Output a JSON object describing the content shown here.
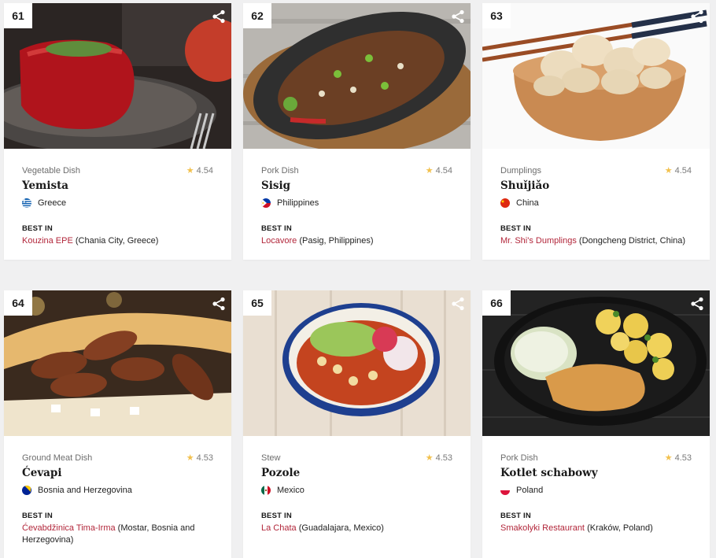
{
  "dishes": [
    {
      "rank": "61",
      "category": "Vegetable Dish",
      "rating": "4.54",
      "name": "Yemista",
      "country": "Greece",
      "best_in_label": "BEST IN",
      "venue": "Kouzina EPE",
      "location": "(Chania City, Greece)"
    },
    {
      "rank": "62",
      "category": "Pork Dish",
      "rating": "4.54",
      "name": "Sisig",
      "country": "Philippines",
      "best_in_label": "BEST IN",
      "venue": "Locavore",
      "location": "(Pasig, Philippines)"
    },
    {
      "rank": "63",
      "category": "Dumplings",
      "rating": "4.54",
      "name": "Shuǐjiǎo",
      "country": "China",
      "best_in_label": "BEST IN",
      "venue": "Mr. Shi's Dumplings",
      "location": "(Dongcheng District, China)"
    },
    {
      "rank": "64",
      "category": "Ground Meat Dish",
      "rating": "4.53",
      "name": "Ćevapi",
      "country": "Bosnia and Herzegovina",
      "best_in_label": "BEST IN",
      "venue": "Ćevabdžinica Tima-Irma",
      "location": "(Mostar, Bosnia and Herzegovina)"
    },
    {
      "rank": "65",
      "category": "Stew",
      "rating": "4.53",
      "name": "Pozole",
      "country": "Mexico",
      "best_in_label": "BEST IN",
      "venue": "La Chata",
      "location": "(Guadalajara, Mexico)"
    },
    {
      "rank": "66",
      "category": "Pork Dish",
      "rating": "4.53",
      "name": "Kotlet schabowy",
      "country": "Poland",
      "best_in_label": "BEST IN",
      "venue": "Smakolyki Restaurant",
      "location": "(Kraków, Poland)"
    }
  ],
  "colors": {
    "link": "#b2263a",
    "star": "#f2c14e"
  },
  "icons": {
    "share": "share-icon",
    "star": "star-icon"
  }
}
